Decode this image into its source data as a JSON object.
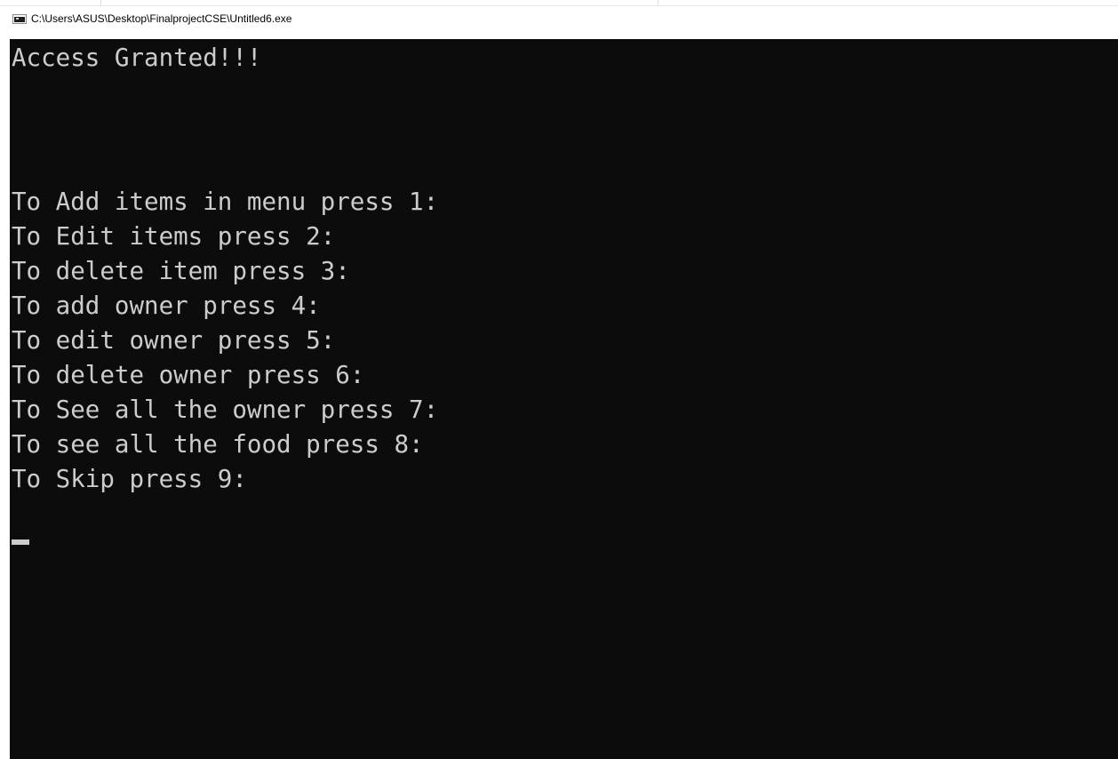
{
  "window": {
    "title": "C:\\Users\\ASUS\\Desktop\\FinalprojectCSE\\Untitled6.exe",
    "icon": "console-app-icon"
  },
  "console": {
    "background": "#0c0c0c",
    "foreground": "#cccccc",
    "status_line": "Access Granted!!!",
    "menu_lines": [
      "To Add items in menu press 1:",
      "To Edit items press 2:",
      "To delete item press 3:",
      "To add owner press 4:",
      "To edit owner press 5:",
      "To delete owner press 6:",
      "To See all the owner press 7:",
      "To see all the food press 8:",
      "To Skip press 9:"
    ]
  }
}
